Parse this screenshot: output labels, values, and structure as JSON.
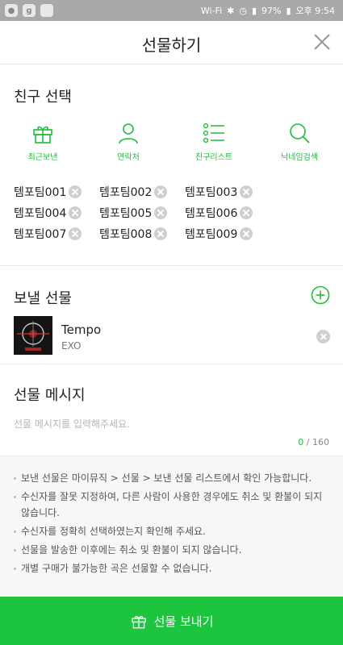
{
  "status_bar": {
    "wifi_text": "Wi-Fi",
    "battery": "97%",
    "time": "오후 9:54"
  },
  "header": {
    "title": "선물하기"
  },
  "friend_select": {
    "title": "친구 선택",
    "tabs": [
      {
        "label": "최근보낸",
        "icon": "gift-icon"
      },
      {
        "label": "연락처",
        "icon": "person-icon"
      },
      {
        "label": "친구리스트",
        "icon": "list-icon"
      },
      {
        "label": "닉네임검색",
        "icon": "search-icon"
      }
    ],
    "recipients": [
      "템포팀001",
      "템포팀002",
      "템포팀003",
      "템포팀004",
      "템포팀005",
      "템포팀006",
      "템포팀007",
      "템포팀008",
      "템포팀009"
    ]
  },
  "gift": {
    "title": "보낼 선물",
    "song": {
      "title": "Tempo",
      "artist": "EXO"
    }
  },
  "message": {
    "title": "선물 메시지",
    "placeholder": "선물 메시지를 입력해주세요.",
    "count": "0",
    "max": "/ 160"
  },
  "notices": [
    "보낸 선물은 마이뮤직 > 선물 > 보낸 선물 리스트에서 확인 가능합니다.",
    "수신자를 잘못 지정하여, 다른 사람이 사용한 경우에도 취소 및 환불이 되지 않습니다.",
    "수신자를 정확히 선택하였는지 확인해 주세요.",
    "선물을 발송한 이후에는 취소 및 환불이 되지 않습니다.",
    "개별 구매가 불가능한 곡은 선물할 수 없습니다."
  ],
  "send_button": {
    "label": "선물 보내기"
  },
  "colors": {
    "accent": "#1dc53e",
    "accent_text": "#1dbf3a",
    "status_bar": "#a9a9a9"
  }
}
